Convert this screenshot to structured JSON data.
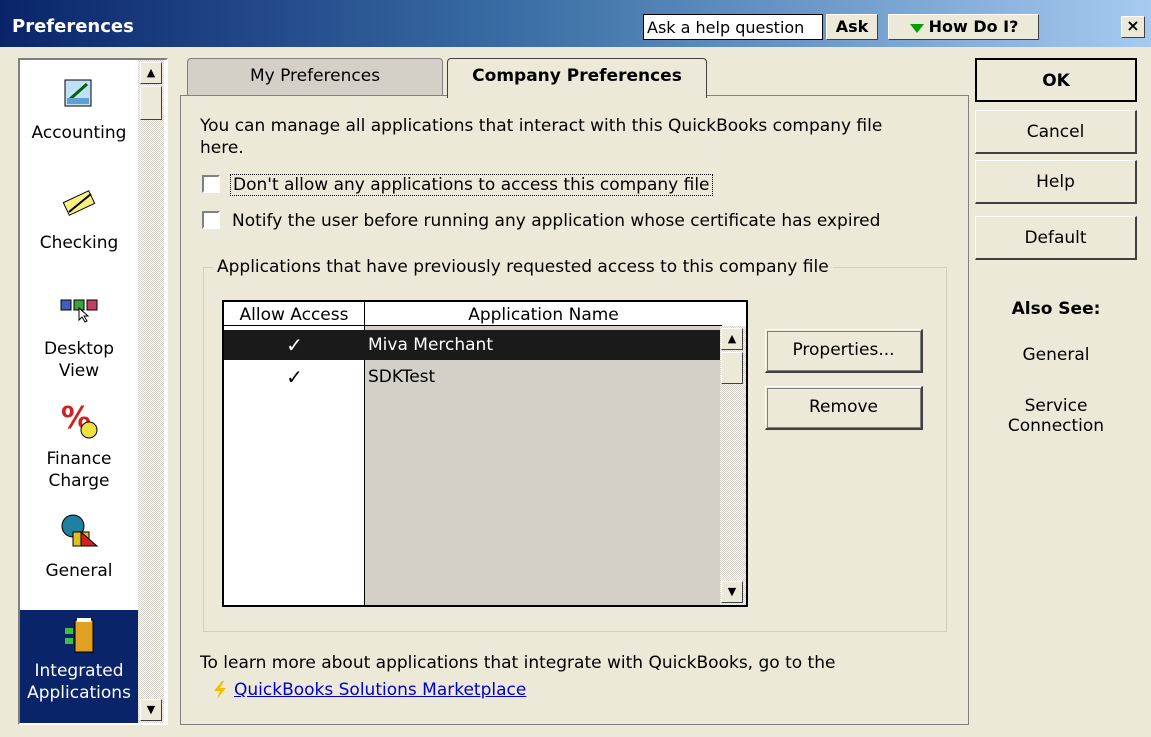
{
  "window": {
    "title": "Preferences",
    "help_question": "Ask a help question",
    "ask_label": "Ask",
    "howdoi_label": "How Do I?",
    "close_label": "×"
  },
  "sidebar": {
    "items": [
      {
        "label": "Accounting",
        "icon": "accounting-icon"
      },
      {
        "label": "Checking",
        "icon": "checking-icon"
      },
      {
        "label": "Desktop View",
        "line1": "Desktop",
        "line2": "View",
        "icon": "desktop-view-icon"
      },
      {
        "label": "Finance Charge",
        "line1": "Finance",
        "line2": "Charge",
        "icon": "finance-charge-icon"
      },
      {
        "label": "General",
        "icon": "general-icon"
      },
      {
        "label": "Integrated Applications",
        "line1": "Integrated",
        "line2": "Applications",
        "icon": "integrated-applications-icon",
        "selected": true
      }
    ]
  },
  "tabs": {
    "my_preferences": "My Preferences",
    "company_preferences": "Company Preferences",
    "active": "Company Preferences"
  },
  "panel": {
    "intro_line1": "You can manage all applications that interact with this QuickBooks company file",
    "intro_line2": "here.",
    "dont_allow_label": "Don't allow any applications to access this company file",
    "notify_label": "Notify the user before running any application whose certificate has expired",
    "group_label": "Applications that have previously requested access to this company file",
    "columns": [
      "Allow Access",
      "Application Name"
    ],
    "rows": [
      {
        "allow": "✓",
        "name": "Miva Merchant",
        "selected": true
      },
      {
        "allow": "✓",
        "name": "SDKTest",
        "selected": false
      }
    ],
    "properties_label": "Properties...",
    "remove_label": "Remove",
    "learn_more": "To learn more about applications that integrate with QuickBooks, go to the",
    "marketplace_link": "QuickBooks Solutions Marketplace"
  },
  "buttons": {
    "ok": "OK",
    "cancel": "Cancel",
    "help": "Help",
    "default": "Default"
  },
  "also_see": {
    "title": "Also See:",
    "general": "General",
    "service_line1": "Service",
    "service_line2": "Connection"
  },
  "colors": {
    "selection": "#0a246a",
    "link": "#0000cc",
    "background": "#ece9d8"
  }
}
